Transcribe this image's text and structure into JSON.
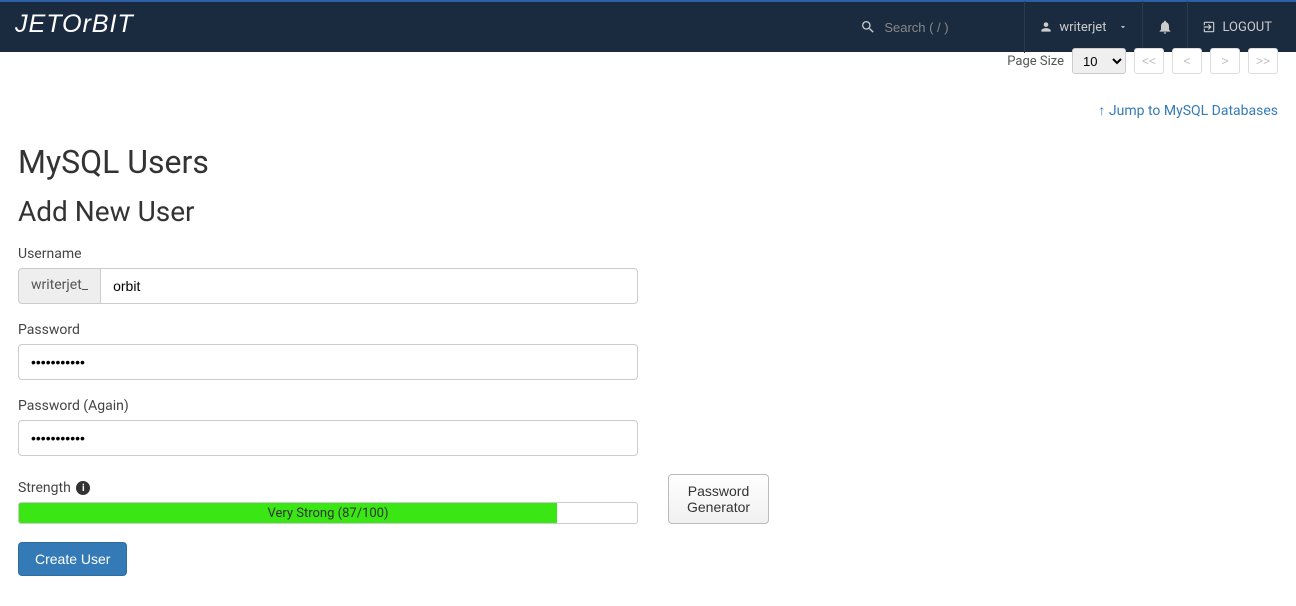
{
  "navbar": {
    "brand": "JETORBIT",
    "search_placeholder": "Search ( / )",
    "username": "writerjet",
    "logout_label": "LOGOUT"
  },
  "top": {
    "page_size_label": "Page Size",
    "page_size_value": "10",
    "jump_link": "Jump to MySQL Databases"
  },
  "headings": {
    "section": "MySQL Users",
    "subsection": "Add New User"
  },
  "form": {
    "username_label": "Username",
    "username_prefix": "writerjet_",
    "username_value": "orbit",
    "password_label": "Password",
    "password_value": "•••••••••••",
    "password_again_label": "Password (Again)",
    "password_again_value": "•••••••••••",
    "strength_label": "Strength",
    "strength_text": "Very Strong (87/100)",
    "strength_percent": 87,
    "generator_label": "Password Generator",
    "submit_label": "Create User"
  }
}
